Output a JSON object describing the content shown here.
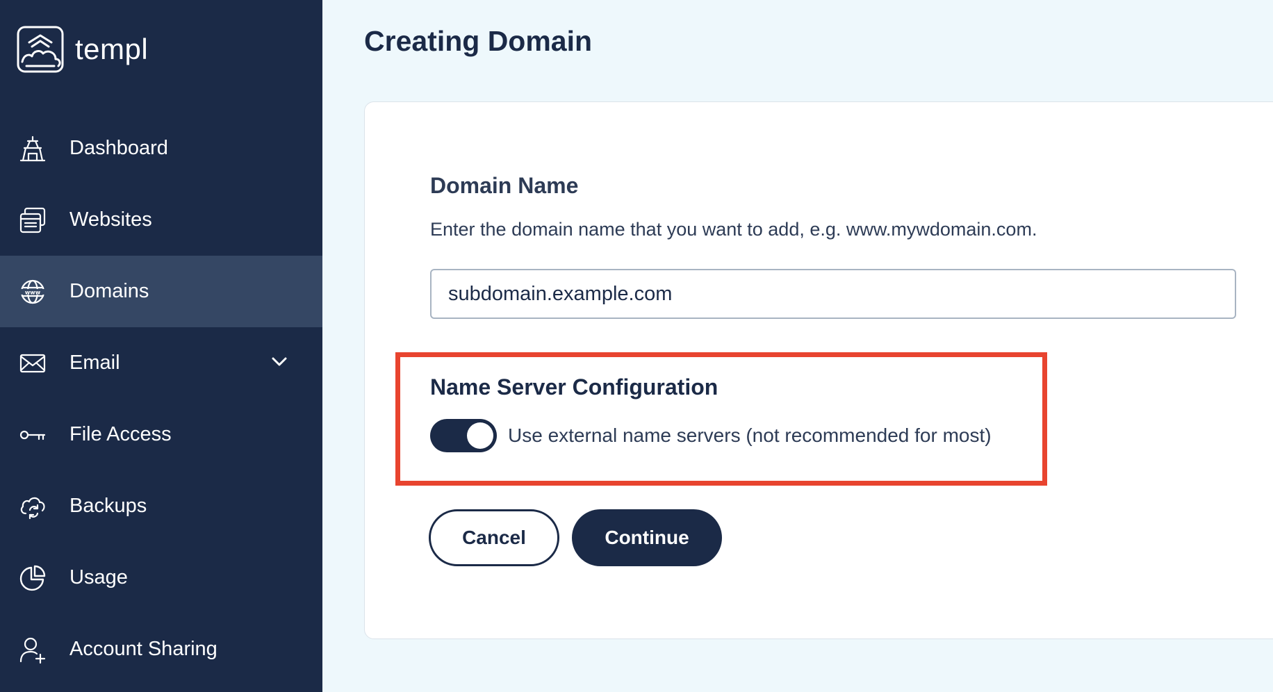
{
  "brand": {
    "name": "templ"
  },
  "sidebar": {
    "items": [
      {
        "label": "Dashboard",
        "icon": "dashboard-icon"
      },
      {
        "label": "Websites",
        "icon": "websites-icon"
      },
      {
        "label": "Domains",
        "icon": "globe-icon",
        "active": true
      },
      {
        "label": "Email",
        "icon": "envelope-icon",
        "expandable": true
      },
      {
        "label": "File Access",
        "icon": "key-icon"
      },
      {
        "label": "Backups",
        "icon": "cloud-sync-icon"
      },
      {
        "label": "Usage",
        "icon": "pie-chart-icon"
      },
      {
        "label": "Account Sharing",
        "icon": "add-user-icon"
      }
    ]
  },
  "page": {
    "title": "Creating Domain"
  },
  "form": {
    "domain": {
      "title": "Domain Name",
      "description": "Enter the domain name that you want to add, e.g. www.mywdomain.com.",
      "value": "subdomain.example.com"
    },
    "nameservers": {
      "title": "Name Server Configuration",
      "toggle_label": "Use external name servers (not recommended for most)",
      "toggle_on": true
    },
    "cancel_label": "Cancel",
    "continue_label": "Continue"
  },
  "colors": {
    "sidebar_bg": "#1b2a47",
    "sidebar_active": "#354764",
    "page_bg": "#eef8fc",
    "highlight": "#e8442f"
  }
}
